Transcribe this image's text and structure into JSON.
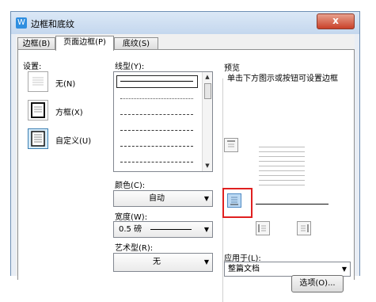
{
  "window": {
    "title": "边框和底纹",
    "close_label": "x"
  },
  "tabs": [
    {
      "label": "边框(B)"
    },
    {
      "label": "页面边框(P)"
    },
    {
      "label": "底纹(S)"
    }
  ],
  "settings": {
    "label": "设置:",
    "items": [
      {
        "label": "无(N)"
      },
      {
        "label": "方框(X)"
      },
      {
        "label": "自定义(U)"
      }
    ]
  },
  "line_style": {
    "label": "线型(Y):"
  },
  "color": {
    "label": "颜色(C):",
    "value": "自动"
  },
  "width": {
    "label": "宽度(W):",
    "value": "0.5  磅"
  },
  "art": {
    "label": "艺术型(R):",
    "value": "无"
  },
  "preview": {
    "label": "预览",
    "hint": "单击下方图示或按钮可设置边框"
  },
  "apply_to": {
    "label": "应用于(L):",
    "value": "整篇文档"
  },
  "options_button": {
    "label": "选项(O)..."
  },
  "colors": {
    "highlight": "#e02020",
    "selection": "#3c7fb1"
  }
}
